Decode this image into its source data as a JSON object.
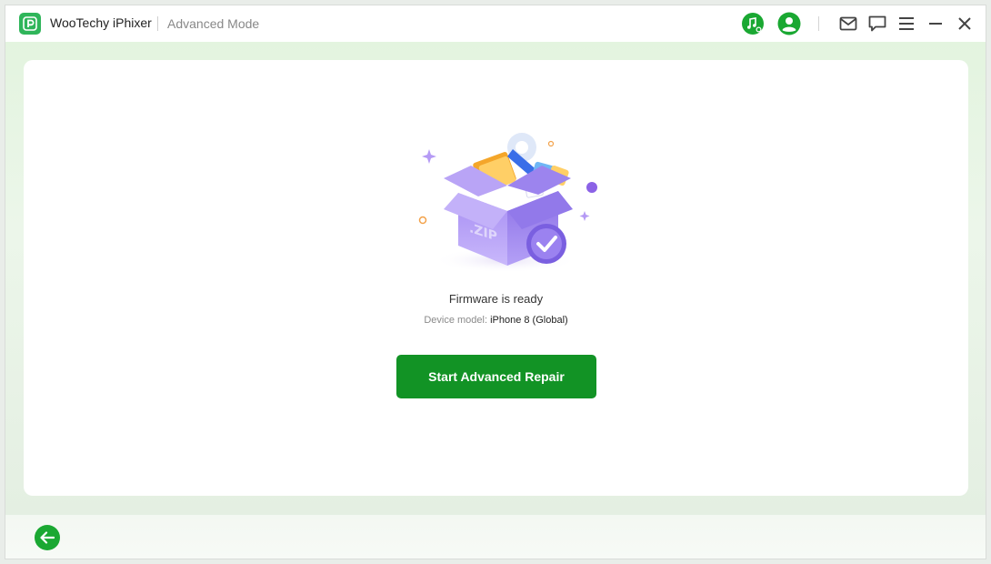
{
  "titlebar": {
    "app_name": "WooTechy iPhixer",
    "mode": "Advanced Mode",
    "icons": [
      "app-logo-icon",
      "music-search-icon",
      "user-account-icon",
      "mail-icon",
      "feedback-icon",
      "menu-icon",
      "minimize-icon",
      "close-icon"
    ]
  },
  "main": {
    "illustration": "zip-firmware-box-with-checkmark",
    "zip_text": ".ZIP",
    "status": "Firmware is ready",
    "device_label": "Device model:",
    "device_value": "iPhone 8 (Global)",
    "start_button": "Start Advanced Repair"
  },
  "footer": {
    "back_icon": "back-arrow-icon"
  },
  "colors": {
    "accent": "#129325",
    "icon_green": "#1aa832",
    "box_purple": "#8b74e6"
  }
}
